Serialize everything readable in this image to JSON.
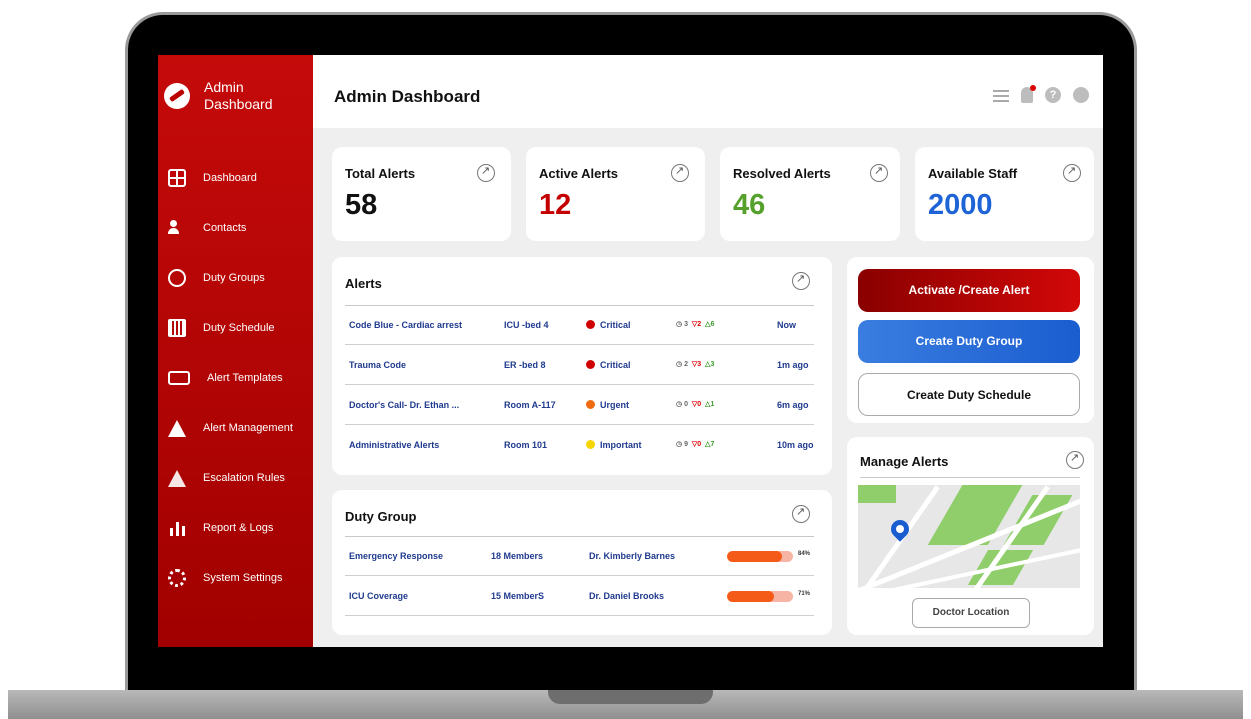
{
  "sidebar": {
    "brand": "Admin Dashboard",
    "items": [
      {
        "label": "Dashboard",
        "icon": "dashboard-grid-icon"
      },
      {
        "label": "Contacts",
        "icon": "contacts-icon"
      },
      {
        "label": "Duty Groups",
        "icon": "duty-groups-icon"
      },
      {
        "label": "Duty Schedule",
        "icon": "calendar-icon"
      },
      {
        "label": "Alert Templates",
        "icon": "alert-templates-icon"
      },
      {
        "label": "Alert Management",
        "icon": "warning-icon"
      },
      {
        "label": "Escalation Rules",
        "icon": "escalation-icon"
      },
      {
        "label": "Report & Logs",
        "icon": "bar-chart-icon"
      },
      {
        "label": "System Settings",
        "icon": "gear-icon"
      }
    ]
  },
  "header": {
    "title": "Admin Dashboard"
  },
  "stats": [
    {
      "title": "Total Alerts",
      "value": "58",
      "color": "#111111"
    },
    {
      "title": "Active Alerts",
      "value": "12",
      "color": "#c40000"
    },
    {
      "title": "Resolved Alerts",
      "value": "46",
      "color": "#56a12c"
    },
    {
      "title": "Available Staff",
      "value": "2000",
      "color": "#1e64d6"
    }
  ],
  "alerts": {
    "title": "Alerts",
    "rows": [
      {
        "name": "Code Blue - Cardiac arrest",
        "location": "ICU -bed 4",
        "severity": "Critical",
        "severity_color": "#d00000",
        "clock": "3",
        "down": "2",
        "up": "6",
        "time": "Now"
      },
      {
        "name": "Trauma Code",
        "location": "ER -bed 8",
        "severity": "Critical",
        "severity_color": "#d00000",
        "clock": "2",
        "down": "3",
        "up": "3",
        "time": "1m ago"
      },
      {
        "name": "Doctor's Call- Dr. Ethan ...",
        "location": "Room A-117",
        "severity": "Urgent",
        "severity_color": "#f06a10",
        "clock": "0",
        "down": "0",
        "up": "1",
        "time": "6m ago"
      },
      {
        "name": "Administrative Alerts",
        "location": "Room 101",
        "severity": "Important",
        "severity_color": "#f5d400",
        "clock": "9",
        "down": "0",
        "up": "7",
        "time": "10m ago"
      }
    ]
  },
  "actions": {
    "activate": "Activate /Create Alert",
    "create_group": "Create Duty Group",
    "create_schedule": "Create Duty Schedule"
  },
  "duty_group": {
    "title": "Duty Group",
    "rows": [
      {
        "name": "Emergency Response",
        "members": "18 Members",
        "lead": "Dr. Kimberly Barnes",
        "progress": 0.84,
        "pct": "84%"
      },
      {
        "name": "ICU Coverage",
        "members": "15 MemberS",
        "lead": "Dr. Daniel Brooks",
        "progress": 0.71,
        "pct": "71%"
      }
    ]
  },
  "manage_alerts": {
    "title": "Manage Alerts",
    "button": "Doctor Location"
  }
}
